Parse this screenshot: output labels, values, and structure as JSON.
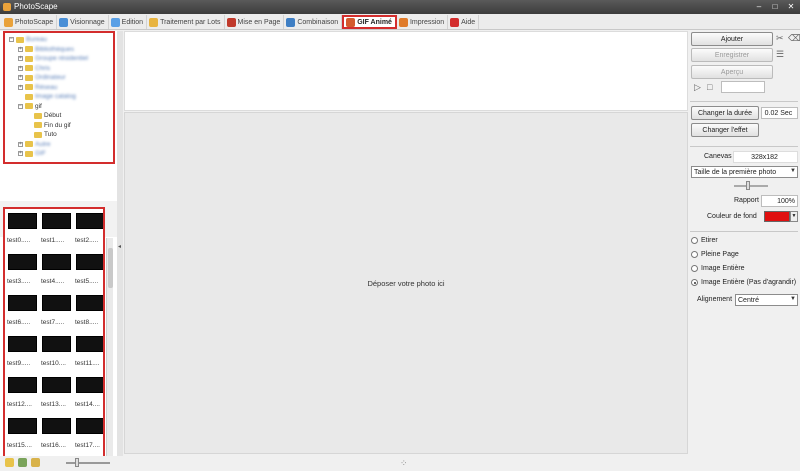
{
  "window": {
    "title": "PhotoScape",
    "controls": [
      "–",
      "□",
      "✕"
    ]
  },
  "tabs": [
    {
      "label": "PhotoScape",
      "icon": "photoscape-icon",
      "color": "#e9a23b"
    },
    {
      "label": "Visionnage",
      "icon": "viewer-icon",
      "color": "#4a8fd6"
    },
    {
      "label": "Edition",
      "icon": "editor-icon",
      "color": "#5aa0e6"
    },
    {
      "label": "Traitement par Lots",
      "icon": "batch-icon",
      "color": "#e8b440"
    },
    {
      "label": "Mise en Page",
      "icon": "page-icon",
      "color": "#c0392b"
    },
    {
      "label": "Combinaison",
      "icon": "combine-icon",
      "color": "#3f7fc4"
    },
    {
      "label": "GIF Animé",
      "icon": "gif-icon",
      "color": "#d35a2d",
      "active": true
    },
    {
      "label": "Impression",
      "icon": "print-icon",
      "color": "#e07b2a"
    },
    {
      "label": "Aide",
      "icon": "help-icon",
      "color": "#d32d2d"
    }
  ],
  "tree": {
    "nodes": [
      {
        "label": "Bureau",
        "depth": 0,
        "exp": "−",
        "blurred": true
      },
      {
        "label": "Bibliothèques",
        "depth": 1,
        "exp": "+",
        "blurred": true
      },
      {
        "label": "Groupe résidentiel",
        "depth": 1,
        "exp": "+",
        "blurred": true
      },
      {
        "label": "Chris",
        "depth": 1,
        "exp": "+",
        "blurred": true
      },
      {
        "label": "Ordinateur",
        "depth": 1,
        "exp": "+",
        "blurred": true
      },
      {
        "label": "Réseau",
        "depth": 1,
        "exp": "+",
        "blurred": true
      },
      {
        "label": "Image catalog",
        "depth": 1,
        "exp": "",
        "blurred": true
      },
      {
        "label": "gif",
        "depth": 1,
        "exp": "−",
        "blurred": false
      },
      {
        "label": "Début",
        "depth": 2,
        "exp": "",
        "blurred": false
      },
      {
        "label": "Fin du gif",
        "depth": 2,
        "exp": "",
        "blurred": false
      },
      {
        "label": "Tuto",
        "depth": 2,
        "exp": "",
        "blurred": false
      },
      {
        "label": "Autre",
        "depth": 1,
        "exp": "+",
        "blurred": true
      },
      {
        "label": "GIF",
        "depth": 1,
        "exp": "+",
        "blurred": true
      }
    ]
  },
  "thumbnails": [
    "test0.....",
    "test1.....",
    "test2.....",
    "test3.....",
    "test4.....",
    "test5.....",
    "test6.....",
    "test7.....",
    "test8.....",
    "test9.....",
    "test10....",
    "test11....",
    "test12....",
    "test13....",
    "test14....",
    "test15....",
    "test16....",
    "test17...."
  ],
  "canvas": {
    "drop_message": "Déposer votre photo ici"
  },
  "panel": {
    "add_label": "Ajouter",
    "save_label": "Enregistrer",
    "preview_label": "Aperçu",
    "change_duration_label": "Changer la durée",
    "duration_value": "0.02 Sec",
    "change_effect_label": "Changer l'effet",
    "canvas_label": "Canevas",
    "canvas_size": "328x182",
    "size_option": "Taille de la première photo",
    "ratio_label": "Rapport",
    "ratio_value": "100%",
    "bg_color_label": "Couleur de fond",
    "bg_color": "#e01010",
    "options": [
      {
        "label": "Etirer",
        "selected": false
      },
      {
        "label": "Pleine Page",
        "selected": false
      },
      {
        "label": "Image Entière",
        "selected": false
      },
      {
        "label": "Image Entière (Pas d'agrandir)",
        "selected": true
      }
    ],
    "alignment_label": "Alignement",
    "alignment_value": "Centré"
  }
}
